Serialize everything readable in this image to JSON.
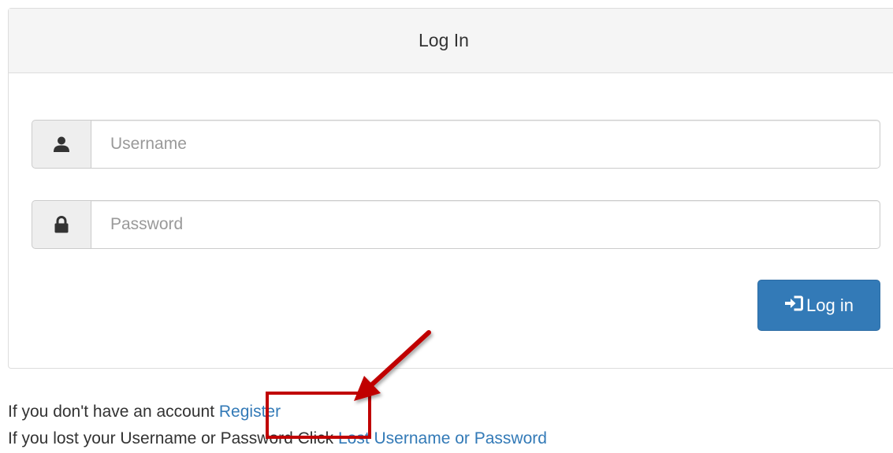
{
  "panel": {
    "title": "Log In"
  },
  "form": {
    "username_placeholder": "Username",
    "password_placeholder": "Password",
    "login_button_label": "Log in",
    "username_icon": "user-icon",
    "password_icon": "lock-icon",
    "login_icon": "sign-in-icon"
  },
  "footer": {
    "register_prefix": "If you don't have an account",
    "register_link": "Register",
    "lost_prefix": "If you lost your Username or Password Click",
    "lost_link": "Lost Username or Password"
  },
  "annotation": {
    "highlight_color": "#c00000",
    "arrow_color": "#c00000"
  },
  "colors": {
    "primary": "#337ab7",
    "heading_bg": "#f5f5f5",
    "addon_bg": "#eeeeee"
  }
}
